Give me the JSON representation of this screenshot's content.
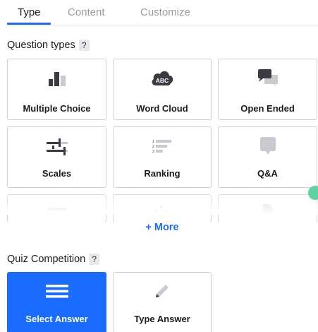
{
  "tabs": [
    {
      "label": "Type"
    },
    {
      "label": "Content"
    },
    {
      "label": "Customize"
    }
  ],
  "question_types": {
    "title": "Question types",
    "help": "?",
    "items": [
      {
        "label": "Multiple Choice",
        "icon": "bar-chart-icon"
      },
      {
        "label": "Word Cloud",
        "icon": "cloud-abc-icon"
      },
      {
        "label": "Open Ended",
        "icon": "speech-bubbles-icon"
      },
      {
        "label": "Scales",
        "icon": "sliders-icon"
      },
      {
        "label": "Ranking",
        "icon": "ranking-list-icon"
      },
      {
        "label": "Q&A",
        "icon": "chat-bubble-icon"
      }
    ],
    "more_label": "+ More"
  },
  "quiz": {
    "title": "Quiz Competition",
    "help": "?",
    "items": [
      {
        "label": "Select Answer",
        "icon": "hamburger-list-icon",
        "selected": true
      },
      {
        "label": "Type Answer",
        "icon": "pencil-icon",
        "selected": false
      }
    ]
  },
  "colors": {
    "accent": "#196cff",
    "border": "#cfd0d6",
    "icon_dark": "#3a3a42",
    "icon_light": "#c9c9cf"
  }
}
